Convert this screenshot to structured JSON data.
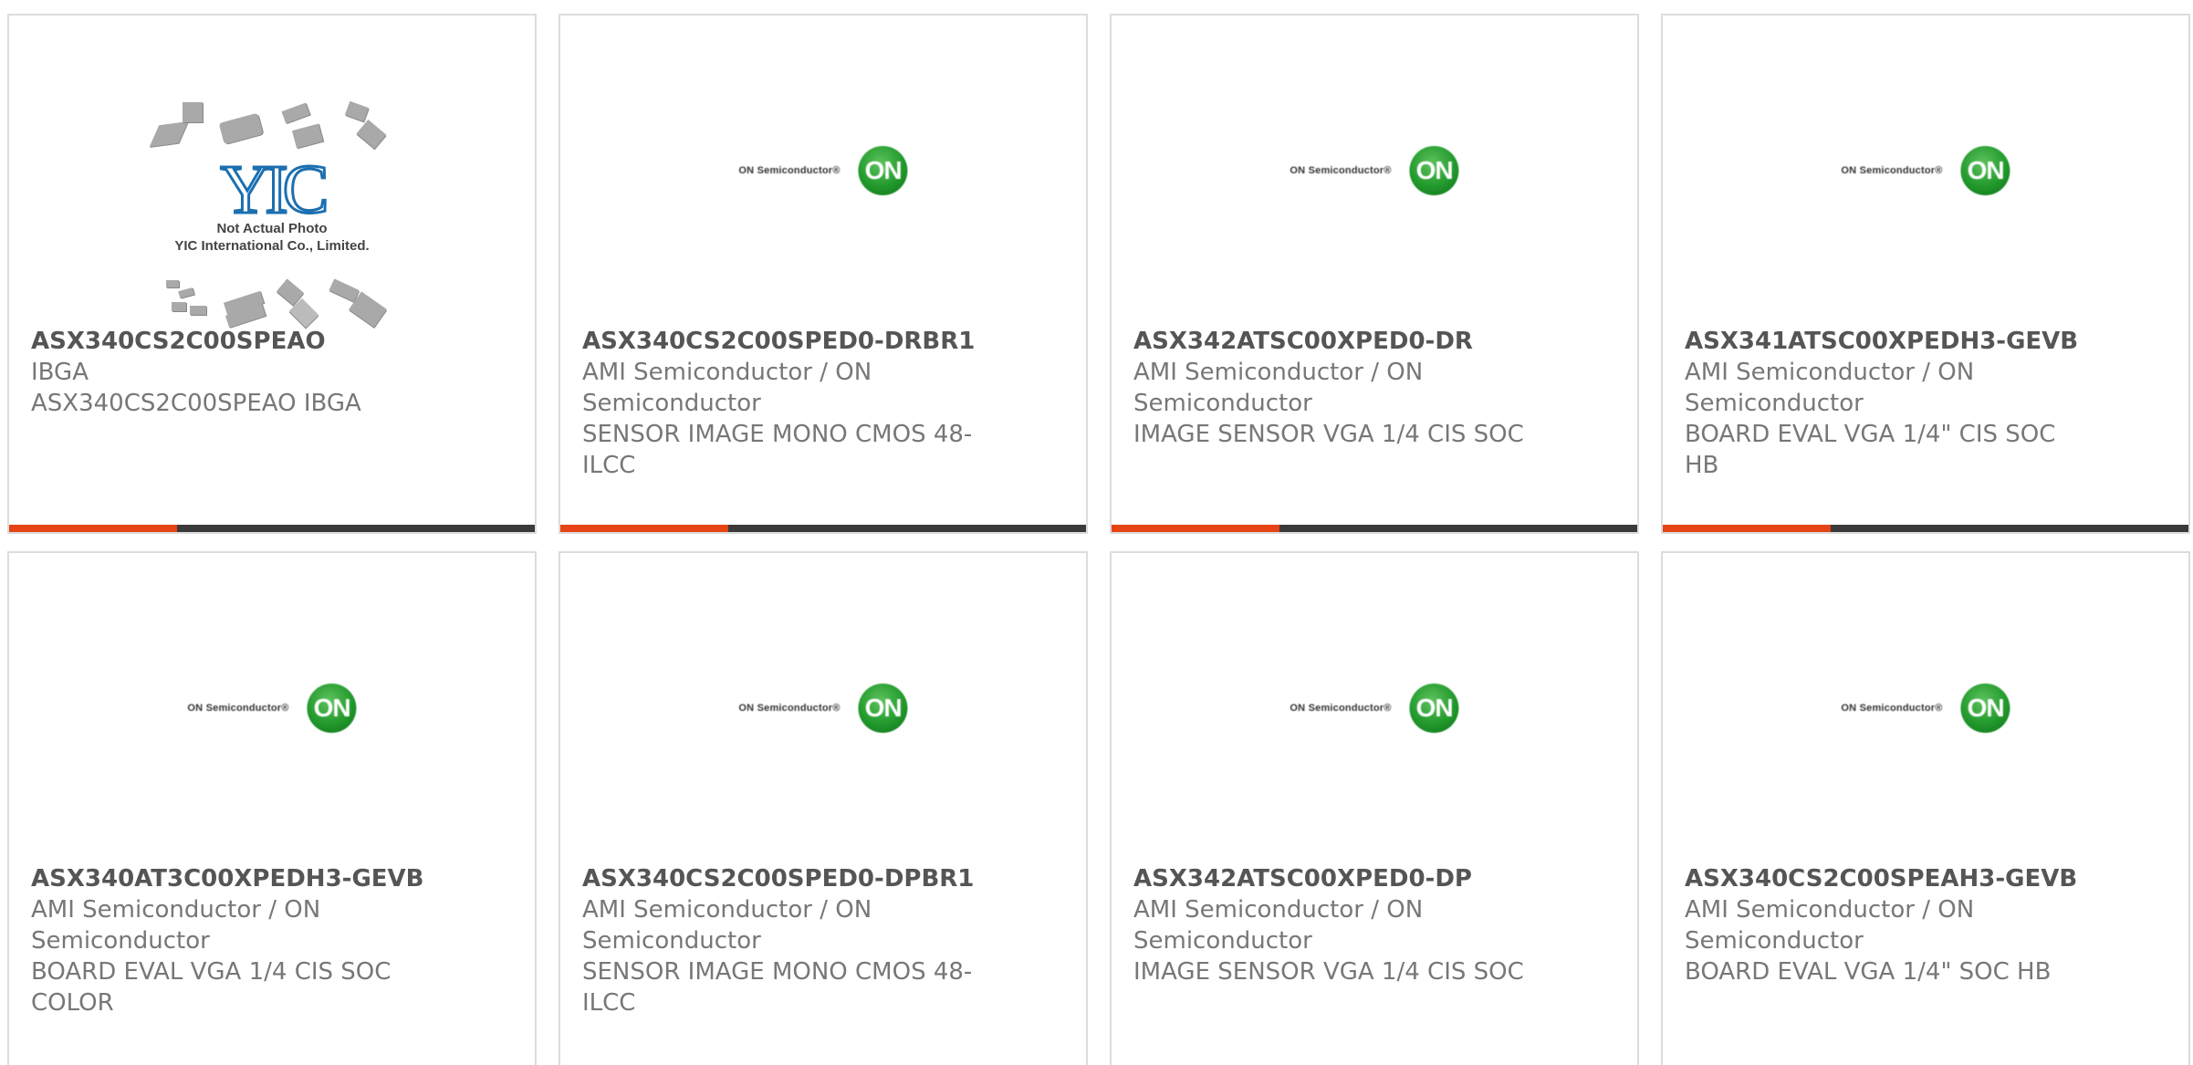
{
  "placeholder": {
    "logo": "YIC",
    "caption_line1": "Not Actual Photo",
    "caption_line2": "YIC International Co., Limited."
  },
  "brand_logo": {
    "text": "ON Semiconductor®",
    "mark": "ON",
    "color": "#229a2c"
  },
  "colors": {
    "accent": "#e64414",
    "bar": "#3a3a3a",
    "part_number": "#555555",
    "text": "#777777"
  },
  "products": [
    {
      "part_number": "ASX340CS2C00SPEAO",
      "manufacturer": "IBGA",
      "description": "ASX340CS2C00SPEAO IBGA",
      "image": "yic-placeholder"
    },
    {
      "part_number": "ASX340CS2C00SPED0-DRBR1",
      "manufacturer": "AMI Semiconductor / ON Semiconductor",
      "description": "SENSOR IMAGE MONO CMOS 48-ILCC",
      "image": "on-semiconductor-logo"
    },
    {
      "part_number": "ASX342ATSC00XPED0-DR",
      "manufacturer": "AMI Semiconductor / ON Semiconductor",
      "description": "IMAGE SENSOR VGA 1/4 CIS SOC",
      "image": "on-semiconductor-logo"
    },
    {
      "part_number": "ASX341ATSC00XPEDH3-GEVB",
      "manufacturer": "AMI Semiconductor / ON Semiconductor",
      "description": "BOARD EVAL VGA 1/4\" CIS SOC HB",
      "image": "on-semiconductor-logo"
    },
    {
      "part_number": "ASX340AT3C00XPEDH3-GEVB",
      "manufacturer": "AMI Semiconductor / ON Semiconductor",
      "description": "BOARD EVAL VGA 1/4 CIS SOC COLOR",
      "image": "on-semiconductor-logo"
    },
    {
      "part_number": "ASX340CS2C00SPED0-DPBR1",
      "manufacturer": "AMI Semiconductor / ON Semiconductor",
      "description": "SENSOR IMAGE MONO CMOS 48-ILCC",
      "image": "on-semiconductor-logo"
    },
    {
      "part_number": "ASX342ATSC00XPED0-DP",
      "manufacturer": "AMI Semiconductor / ON Semiconductor",
      "description": "IMAGE SENSOR VGA 1/4 CIS SOC",
      "image": "on-semiconductor-logo"
    },
    {
      "part_number": "ASX340CS2C00SPEAH3-GEVB",
      "manufacturer": "AMI Semiconductor / ON Semiconductor",
      "description": "BOARD EVAL VGA 1/4\" SOC HB",
      "image": "on-semiconductor-logo"
    }
  ]
}
